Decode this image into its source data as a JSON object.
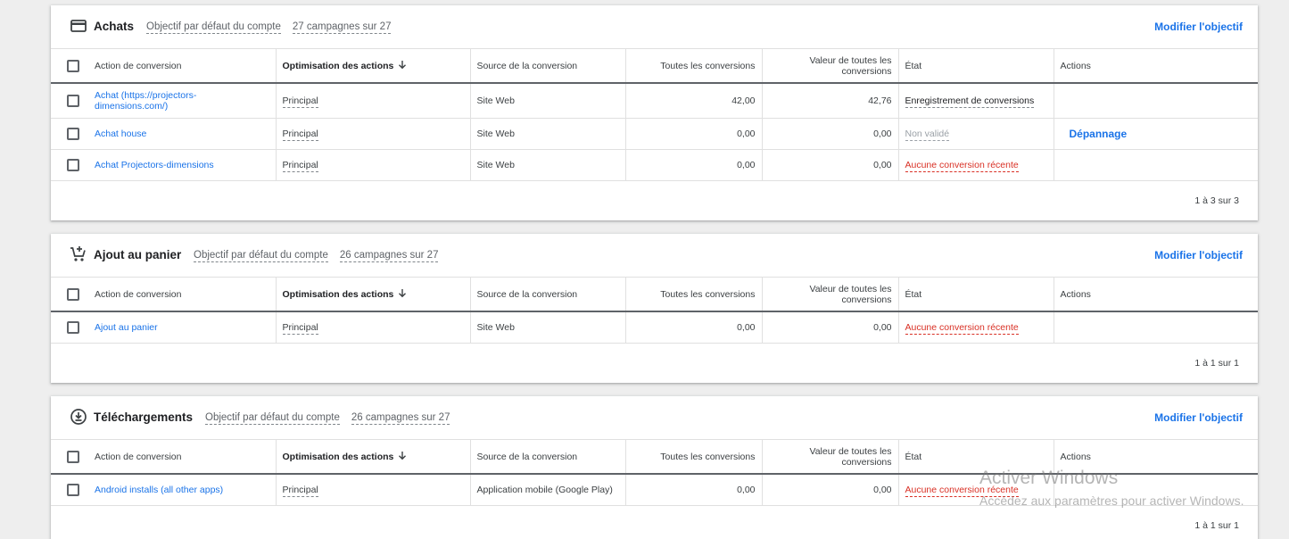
{
  "columns": {
    "action": "Action de conversion",
    "optimization": "Optimisation des actions",
    "source": "Source de la conversion",
    "all_conversions": "Toutes les conversions",
    "value": "Valeur de toutes les conversions",
    "state": "État",
    "actions": "Actions"
  },
  "sections": [
    {
      "title": "Achats",
      "icon": "credit-card-icon",
      "default_goal": "Objectif par défaut du compte",
      "campaigns": "27 campagnes sur 27",
      "modify": "Modifier l'objectif",
      "rows": [
        {
          "name": "Achat (https://projectors-dimensions.com/)",
          "optimization": "Principal",
          "source": "Site Web",
          "all": "42,00",
          "value": "42,76",
          "state": "Enregistrement de conversions",
          "state_kind": "ok",
          "action": ""
        },
        {
          "name": "Achat house",
          "optimization": "Principal",
          "source": "Site Web",
          "all": "0,00",
          "value": "0,00",
          "state": "Non validé",
          "state_kind": "muted",
          "action": "Dépannage"
        },
        {
          "name": "Achat Projectors-dimensions",
          "optimization": "Principal",
          "source": "Site Web",
          "all": "0,00",
          "value": "0,00",
          "state": "Aucune conversion récente",
          "state_kind": "warn",
          "action": ""
        }
      ],
      "pager": "1 à 3 sur 3"
    },
    {
      "title": "Ajout au panier",
      "icon": "add-to-cart-icon",
      "default_goal": "Objectif par défaut du compte",
      "campaigns": "26 campagnes sur 27",
      "modify": "Modifier l'objectif",
      "rows": [
        {
          "name": "Ajout au panier",
          "optimization": "Principal",
          "source": "Site Web",
          "all": "0,00",
          "value": "0,00",
          "state": "Aucune conversion récente",
          "state_kind": "warn",
          "action": ""
        }
      ],
      "pager": "1 à 1 sur 1"
    },
    {
      "title": "Téléchargements",
      "icon": "download-circle-icon",
      "default_goal": "Objectif par défaut du compte",
      "campaigns": "26 campagnes sur 27",
      "modify": "Modifier l'objectif",
      "rows": [
        {
          "name": "Android installs (all other apps)",
          "optimization": "Principal",
          "source": "Application mobile (Google Play)",
          "all": "0,00",
          "value": "0,00",
          "state": "Aucune conversion récente",
          "state_kind": "warn",
          "action": ""
        }
      ],
      "pager": "1 à 1 sur 1"
    }
  ],
  "watermark": {
    "title": "Activer Windows",
    "subtitle": "Accédez aux paramètres pour activer Windows."
  }
}
